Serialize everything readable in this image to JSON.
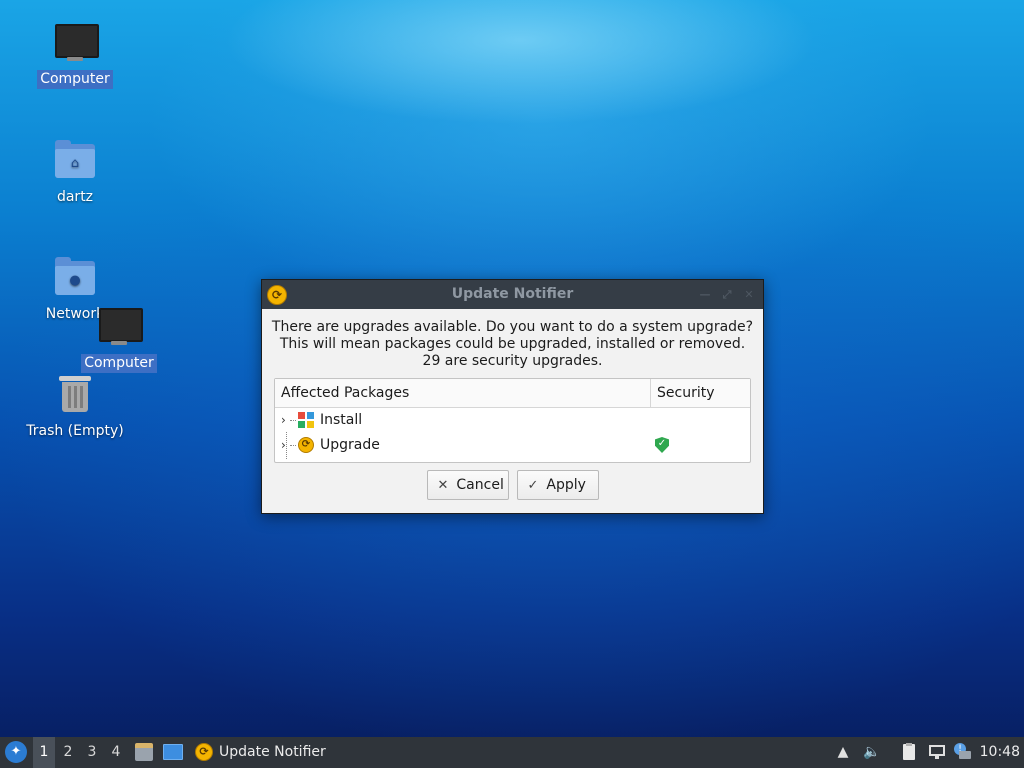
{
  "desktop": {
    "icons": [
      {
        "label": "Computer",
        "icon": "computer-icon"
      },
      {
        "label": "dartz",
        "icon": "home-folder-icon"
      },
      {
        "label": "Network",
        "icon": "network-folder-icon"
      },
      {
        "label": "Computer",
        "icon": "computer-icon"
      },
      {
        "label": "Trash (Empty)",
        "icon": "trash-icon"
      }
    ]
  },
  "dialog": {
    "title": "Update Notifier",
    "message_line1": "There are upgrades available. Do you want to do a system upgrade?",
    "message_line2": "This will mean packages could be upgraded, installed or removed.",
    "message_line3": "29 are security upgrades.",
    "table": {
      "headers": [
        "Affected Packages",
        "Security"
      ],
      "rows": [
        {
          "label": "Install",
          "icon": "install-packages-icon",
          "security": ""
        },
        {
          "label": "Upgrade",
          "icon": "upgrade-packages-icon",
          "security": "shield-check-icon"
        }
      ]
    },
    "cancel_label": "Cancel",
    "apply_label": "Apply"
  },
  "taskbar": {
    "workspaces": [
      "1",
      "2",
      "3",
      "4"
    ],
    "active_workspace": "1",
    "task_label": "Update Notifier",
    "clock": "10:48"
  },
  "colors": {
    "selection": "#3d6fc4",
    "titlebar": "#353d46",
    "taskbar": "#2f343a",
    "security_green": "#2fa84f"
  }
}
